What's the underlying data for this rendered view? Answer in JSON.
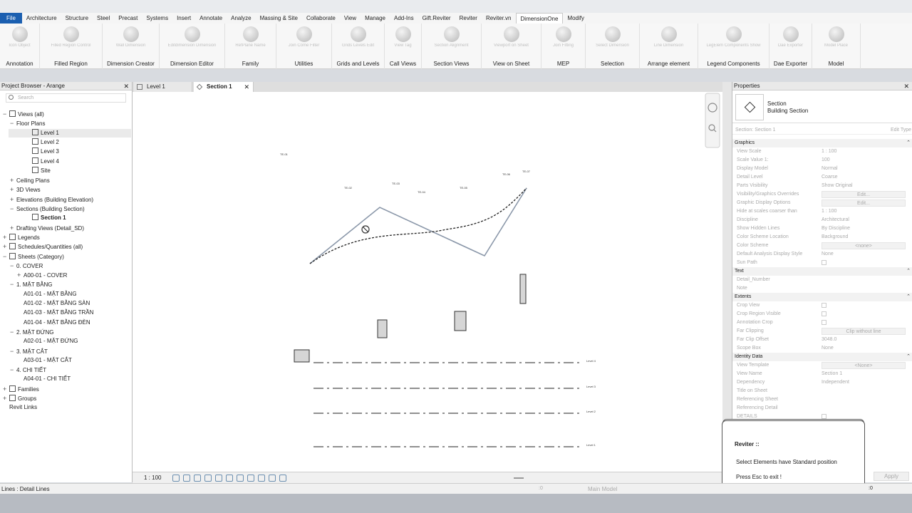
{
  "menu": [
    "File",
    "Architecture",
    "Structure",
    "Steel",
    "Precast",
    "Systems",
    "Insert",
    "Annotate",
    "Analyze",
    "Massing & Site",
    "Collaborate",
    "View",
    "Manage",
    "Add-Ins",
    "Gift.Reviter",
    "Reviter",
    "Reviter.vn",
    "DimensionOne",
    "Modify"
  ],
  "ribbon_panels": [
    {
      "label": "Annotation",
      "button": "Icon Object"
    },
    {
      "label": "Filled Region",
      "button": "Filled Region Control"
    },
    {
      "label": "Dimension Creator",
      "button": "Wall Dimension"
    },
    {
      "label": "Dimension Editor",
      "button": "Editdimension Dimension"
    },
    {
      "label": "Family",
      "button": "RefPlane Name"
    },
    {
      "label": "Utilities",
      "button": "Join Come Filter"
    },
    {
      "label": "Grids and Levels",
      "button": "Grids Levels Edit"
    },
    {
      "label": "Call Views",
      "button": "View Tag"
    },
    {
      "label": "Section Views",
      "button": "Section Alignment"
    },
    {
      "label": "View on Sheet",
      "button": "Viewport on Sheet"
    },
    {
      "label": "MEP",
      "button": "Join Fitting"
    },
    {
      "label": "Selection",
      "button": "Select Dimension"
    },
    {
      "label": "Arrange element",
      "button": "Line Dimension"
    },
    {
      "label": "Legend Components",
      "button": "LegElem Components Show"
    },
    {
      "label": "Dae Exporter",
      "button": "Dae Exporter"
    },
    {
      "label": "Model",
      "button": "Model Place"
    }
  ],
  "project_browser": {
    "title": "Project Browser - Arange",
    "search_placeholder": "Search",
    "items": [
      {
        "text": "Views (all)",
        "toggle": "−"
      },
      {
        "text": "Floor Plans",
        "toggle": "−"
      },
      {
        "text": "Level 1",
        "toggle": ""
      },
      {
        "text": "Level 2",
        "toggle": ""
      },
      {
        "text": "Level 3",
        "toggle": ""
      },
      {
        "text": "Level 4",
        "toggle": ""
      },
      {
        "text": "Site",
        "toggle": ""
      },
      {
        "text": "Ceiling Plans",
        "toggle": "+"
      },
      {
        "text": "3D Views",
        "toggle": "+"
      },
      {
        "text": "Elevations (Building Elevation)",
        "toggle": "+"
      },
      {
        "text": "Sections (Building Section)",
        "toggle": "−"
      },
      {
        "text": "Section 1",
        "toggle": ""
      },
      {
        "text": "Drafting Views (Detail_SD)",
        "toggle": "+"
      },
      {
        "text": "Legends",
        "toggle": "+"
      },
      {
        "text": "Schedules/Quantities (all)",
        "toggle": "+"
      },
      {
        "text": "Sheets (Category)",
        "toggle": "−"
      },
      {
        "text": "0. COVER",
        "toggle": "−"
      },
      {
        "text": "A00-01 - COVER",
        "toggle": "+"
      },
      {
        "text": "1. MẶT BẰNG",
        "toggle": "−"
      },
      {
        "text": "A01-01 - MẶT BẰNG",
        "toggle": ""
      },
      {
        "text": "A01-02 - MẶT BẰNG SÀN",
        "toggle": ""
      },
      {
        "text": "A01-03 - MẶT BẰNG TRẦN",
        "toggle": ""
      },
      {
        "text": "A01-04 - MẶT BẰNG ĐÈN",
        "toggle": ""
      },
      {
        "text": "2. MẶT ĐỨNG",
        "toggle": "−"
      },
      {
        "text": "A02-01 - MẶT ĐỨNG",
        "toggle": ""
      },
      {
        "text": "3. MẶT CẮT",
        "toggle": "−"
      },
      {
        "text": "A03-01 - MẶT CẮT",
        "toggle": ""
      },
      {
        "text": "4. CHI TIẾT",
        "toggle": "−"
      },
      {
        "text": "A04-01 - CHI TIẾT",
        "toggle": ""
      },
      {
        "text": "Families",
        "toggle": "+"
      },
      {
        "text": "Groups",
        "toggle": "+"
      },
      {
        "text": "Revit Links",
        "toggle": ""
      }
    ]
  },
  "tabs": [
    {
      "label": "Level 1"
    },
    {
      "label": "Section 1"
    }
  ],
  "canvas": {
    "point_labels": [
      "TE-01",
      "TE-02",
      "TE-03",
      "TE-04",
      "TE-05",
      "TE-06",
      "TE-07"
    ],
    "level_labels": [
      "Level 4",
      "Level 3",
      "Level 2",
      "Level 1"
    ]
  },
  "viewbar": {
    "scale": "1 : 100"
  },
  "properties": {
    "title": "Properties",
    "type_family": "Section",
    "type_name": "Building Section",
    "instance_label": "Section: Section 1",
    "edit_type": "Edit Type",
    "apply": "Apply",
    "rows": [
      {
        "group": "Graphics"
      },
      {
        "name": "View Scale",
        "value": "1 : 100"
      },
      {
        "name": "Scale Value    1:",
        "value": "100"
      },
      {
        "name": "Display Model",
        "value": "Normal"
      },
      {
        "name": "Detail Level",
        "value": "Coarse"
      },
      {
        "name": "Parts Visibility",
        "value": "Show Original"
      },
      {
        "name": "Visibility/Graphics Overrides",
        "value": "Edit...",
        "btn": true
      },
      {
        "name": "Graphic Display Options",
        "value": "Edit...",
        "btn": true
      },
      {
        "name": "Hide at scales coarser than",
        "value": "1 : 100"
      },
      {
        "name": "Discipline",
        "value": "Architectural"
      },
      {
        "name": "Show Hidden Lines",
        "value": "By Discipline"
      },
      {
        "name": "Color Scheme Location",
        "value": "Background"
      },
      {
        "name": "Color Scheme",
        "value": "<none>",
        "btn": true
      },
      {
        "name": "Default Analysis Display Style",
        "value": "None"
      },
      {
        "name": "Sun Path",
        "check": true
      },
      {
        "group": "Text"
      },
      {
        "name": "Detail_Number",
        "value": ""
      },
      {
        "name": "Note",
        "value": ""
      },
      {
        "group": "Extents"
      },
      {
        "name": "Crop View",
        "check": true
      },
      {
        "name": "Crop Region Visible",
        "check": true
      },
      {
        "name": "Annotation Crop",
        "check": true
      },
      {
        "name": "Far Clipping",
        "value": "Clip without line",
        "btn": true
      },
      {
        "name": "Far Clip Offset",
        "value": "3048.0"
      },
      {
        "name": "Scope Box",
        "value": "None"
      },
      {
        "group": "Identity Data"
      },
      {
        "name": "View Template",
        "value": "<None>",
        "btn": true
      },
      {
        "name": "View Name",
        "value": "Section 1"
      },
      {
        "name": "Dependency",
        "value": "Independent"
      },
      {
        "name": "Title on Sheet",
        "value": ""
      },
      {
        "name": "Referencing Sheet",
        "value": ""
      },
      {
        "name": "Referencing Detail",
        "value": ""
      },
      {
        "name": "DETAILS",
        "check": true
      }
    ]
  },
  "popup": {
    "title": "Reviter ::",
    "message": "Select Elements have Standard position",
    "hint": "Press Esc to exit !"
  },
  "status": {
    "text": "Lines : Detail Lines",
    "model": "Main Model",
    "zero1": ":0",
    "zero2": ":0"
  }
}
